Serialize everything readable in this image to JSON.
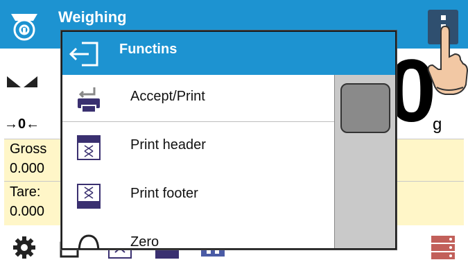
{
  "header": {
    "title": "Weighing",
    "app_icon": "scale-icon",
    "menu_icon": "vertical-dots-icon",
    "color": "#1d93d1"
  },
  "display": {
    "weight_digit": "0",
    "unit": "g",
    "zero_marker": "→0←",
    "stable_icon": "stability-icon"
  },
  "info": {
    "gross_label": "Gross",
    "gross_value": "0.000",
    "tare_label": "Tare:",
    "tare_value": "0.000"
  },
  "popup": {
    "title": "Functins",
    "back_icon": "exit-back-icon",
    "items": [
      {
        "label": "Accept/Print",
        "icon": "printer-accept-icon"
      },
      {
        "label": "Print header",
        "icon": "print-header-icon"
      },
      {
        "label": "Print footer",
        "icon": "print-footer-icon"
      },
      {
        "label": "Zero",
        "icon": "zero-icon"
      }
    ]
  },
  "toolbar": {
    "icons": [
      "settings-gear-icon",
      "zero-scale-icon",
      "print-header-icon",
      "print-footer-icon",
      "units-icon",
      "database-icon"
    ]
  }
}
